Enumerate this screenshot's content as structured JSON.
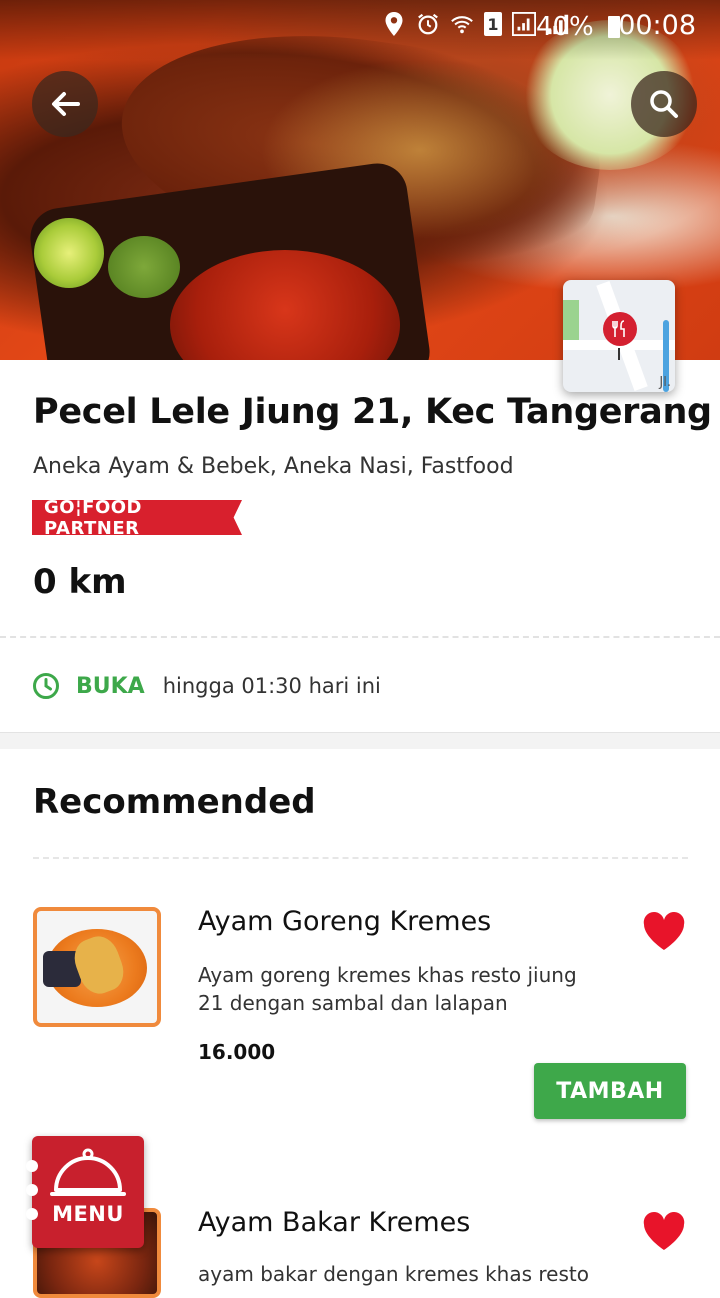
{
  "status_bar": {
    "battery": "40%",
    "time": "00:08",
    "sim": "1",
    "icons": [
      "location-icon",
      "alarm-icon",
      "wifi-icon",
      "sim-icon",
      "signal-icon",
      "signal-icon",
      "battery-icon"
    ]
  },
  "header": {
    "back_icon": "arrow-left-icon",
    "search_icon": "search-icon",
    "map_label": "Jl."
  },
  "restaurant": {
    "name": "Pecel Lele Jiung 21, Kec Tangerang",
    "categories": "Aneka Ayam & Bebek, Aneka Nasi, Fastfood",
    "badge": "GO¦FOOD PARTNER",
    "distance": "0 km",
    "status": "BUKA",
    "hours": "hingga 01:30 hari ini"
  },
  "section": {
    "title": "Recommended"
  },
  "items": [
    {
      "name": "Ayam Goreng Kremes",
      "description": "Ayam goreng kremes khas resto jiung 21 dengan sambal dan lalapan",
      "price": "16.000",
      "button": "TAMBAH",
      "favorited": true
    },
    {
      "name": "Ayam Bakar Kremes",
      "description": "ayam bakar dengan kremes khas resto",
      "favorited": true
    }
  ],
  "fab": {
    "label": "MENU"
  },
  "colors": {
    "brand_red": "#d8202d",
    "open_green": "#3da84a",
    "button_green": "#3ea84a",
    "heart_red": "#e8142a"
  }
}
